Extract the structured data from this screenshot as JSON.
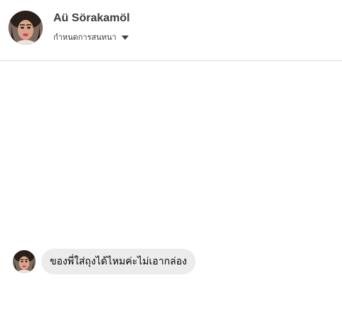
{
  "header": {
    "contact_name": "Aü Sörakamöl",
    "settings_label": "กำหนดการสนทนา",
    "caret_icon": "caret-down-icon"
  },
  "thread": {
    "messages": [
      {
        "direction": "incoming",
        "text": "ของพี่ใส่ถุงได้ไหมค่ะไม่เอากล่อง"
      }
    ]
  },
  "colors": {
    "bubble_incoming": "#ececec",
    "divider": "#dcdde1",
    "text_primary": "#050505"
  }
}
